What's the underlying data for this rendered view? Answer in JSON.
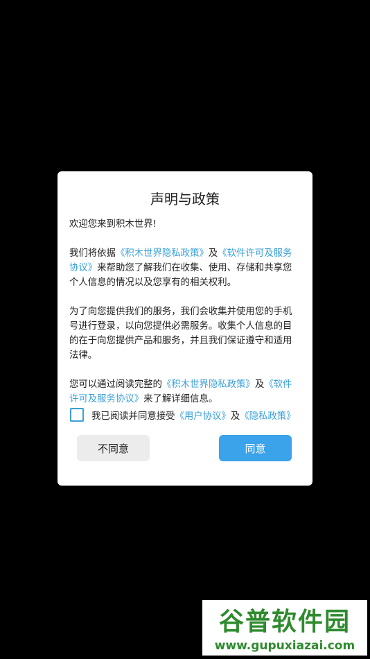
{
  "dialog": {
    "title": "声明与政策",
    "welcome": "欢迎您来到积木世界!",
    "para1": {
      "prefix": "我们将依据",
      "link1": "《积木世界隐私政策》",
      "mid": "及",
      "link2": "《软件许可及服务协议》",
      "suffix": "来帮助您了解我们在收集、使用、存储和共享您个人信息的情况以及您享有的相关权利。"
    },
    "para2": "为了向您提供我们的服务，我们会收集并使用您的手机号进行登录，以向您提供必需服务。收集个人信息的目的在于向您提供产品和服务，并且我们保证遵守和适用法律。",
    "para3": {
      "prefix": "您可以通过阅读完整的",
      "link1": "《积木世界隐私政策》",
      "mid": "及",
      "link2": "《软件许可及服务协议》",
      "suffix": "来了解详细信息。"
    },
    "consent": {
      "checked": false,
      "prefix": "我已阅读并同意接受",
      "link1": "《用户协议》",
      "mid": "及",
      "link2": "《隐私政策》"
    },
    "buttons": {
      "disagree": "不同意",
      "agree": "同意"
    }
  },
  "watermark": {
    "logo_text": "谷普软件园",
    "url": "www.gupuxiazai.com"
  },
  "colors": {
    "background": "#000000",
    "link": "#3aa0d8",
    "agree_button": "#3aa3ea",
    "disagree_button": "#ececec",
    "watermark_green": "#2e8b2e"
  }
}
